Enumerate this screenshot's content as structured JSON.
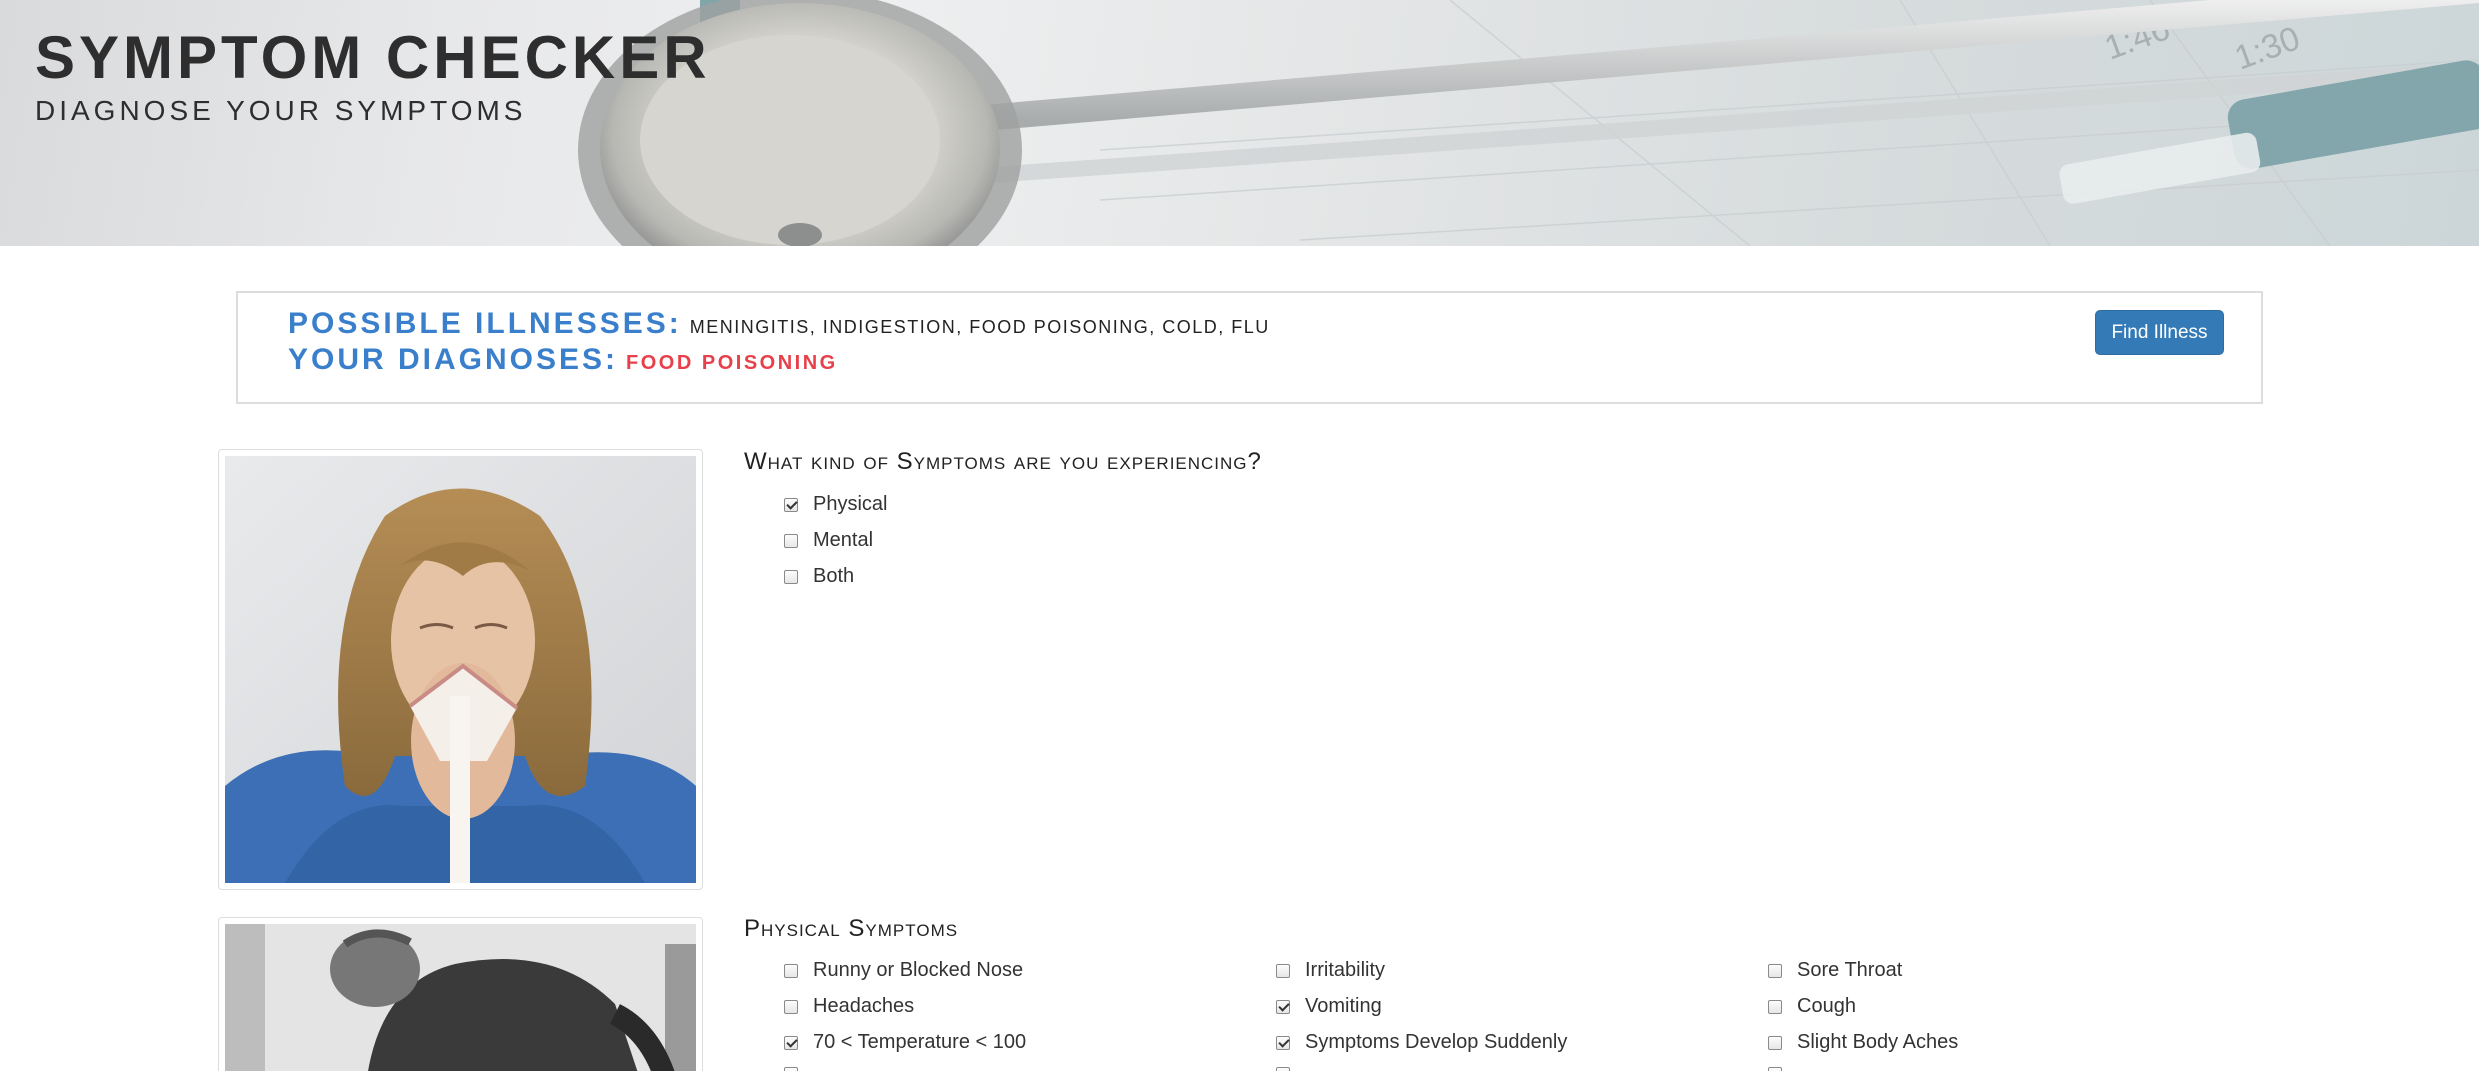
{
  "header": {
    "title": "SYMPTOM CHECKER",
    "subtitle": "DIAGNOSE YOUR SYMPTOMS"
  },
  "results": {
    "possible_label": "POSSIBLE ILLNESSES:",
    "possible_value": "MENINGITIS, INDIGESTION, FOOD POISONING, COLD, FLU",
    "diagnosis_label": "YOUR DIAGNOSES:",
    "diagnosis_value": "FOOD POISONING",
    "find_button": "Find Illness"
  },
  "symptom_type": {
    "question": "What kind of Symptoms are you experiencing?",
    "options": [
      {
        "label": "Physical",
        "checked": true
      },
      {
        "label": "Mental",
        "checked": false
      },
      {
        "label": "Both",
        "checked": false
      }
    ]
  },
  "physical": {
    "title": "Physical Symptoms",
    "columns": [
      [
        {
          "label": "Runny or Blocked Nose",
          "checked": false
        },
        {
          "label": "Headaches",
          "checked": false
        },
        {
          "label": "70 < Temperature < 100",
          "checked": true
        }
      ],
      [
        {
          "label": "Irritability",
          "checked": false
        },
        {
          "label": "Vomiting",
          "checked": true
        },
        {
          "label": "Symptoms Develop Suddenly",
          "checked": true
        }
      ],
      [
        {
          "label": "Sore Throat",
          "checked": false
        },
        {
          "label": "Cough",
          "checked": false
        },
        {
          "label": "Slight Body Aches",
          "checked": false
        }
      ]
    ]
  },
  "colors": {
    "accent_blue": "#3a7fcc",
    "diagnosis_red": "#e8404a",
    "button_blue": "#337ab7"
  }
}
